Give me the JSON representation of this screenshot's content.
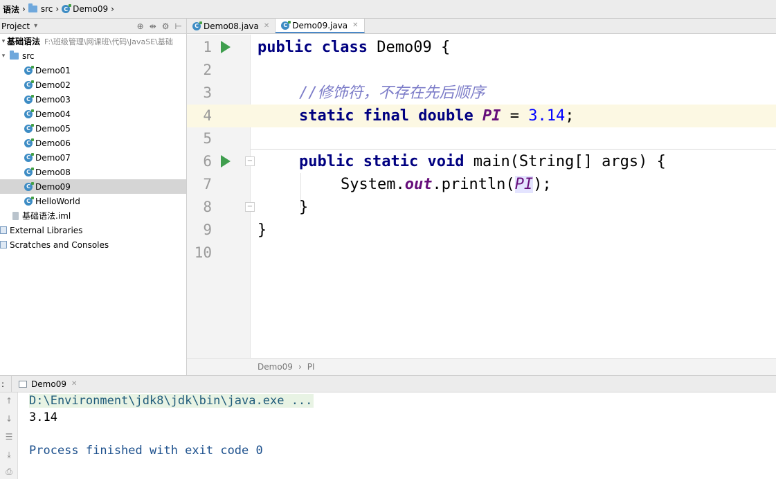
{
  "navbar": {
    "items": [
      "语法",
      "src",
      "Demo09"
    ]
  },
  "project_panel": {
    "title": "Project",
    "dropdown": "▾",
    "root": {
      "name": "基础语法",
      "path": "F:\\班级管理\\网课班\\代码\\JavaSE\\基础"
    },
    "src_label": "src",
    "classes": [
      "Demo01",
      "Demo02",
      "Demo03",
      "Demo04",
      "Demo05",
      "Demo06",
      "Demo07",
      "Demo08",
      "Demo09",
      "HelloWorld"
    ],
    "selected": "Demo09",
    "iml_file": "基础语法.iml",
    "external_libraries": "External Libraries",
    "scratches": "Scratches and Consoles"
  },
  "tabs": [
    {
      "label": "Demo08.java",
      "active": false
    },
    {
      "label": "Demo09.java",
      "active": true
    }
  ],
  "editor": {
    "line_numbers": [
      "1",
      "2",
      "3",
      "4",
      "5",
      "6",
      "7",
      "8",
      "9",
      "10"
    ],
    "line1": {
      "kw1": "public",
      "kw2": "class",
      "name": "Demo09",
      "brace": "{"
    },
    "line3": {
      "comment": "//修饰符，不存在先后顺序"
    },
    "line4": {
      "kw1": "static",
      "kw2": "final",
      "kw3": "double",
      "field": "PI",
      "op": "=",
      "value": "3.14",
      "end": ";"
    },
    "line6": {
      "kw1": "public",
      "kw2": "static",
      "kw3": "void",
      "rest": "main(String[] args) {"
    },
    "line7": {
      "pre": "System.",
      "stat": "out",
      "mid": ".println(",
      "field": "PI",
      "end": ");"
    },
    "line8": {
      "text": "}"
    },
    "line9": {
      "text": "}"
    }
  },
  "editor_breadcrumb": {
    "class": "Demo09",
    "sep": "›",
    "member": "PI"
  },
  "run_window": {
    "prefix": ":",
    "tab_label": "Demo09",
    "console_lines": [
      "D:\\Environment\\jdk8\\jdk\\bin\\java.exe ...",
      "3.14",
      "",
      "Process finished with exit code 0"
    ]
  },
  "colors": {
    "keyword": "#000080",
    "number": "#0000ff",
    "comment": "#7c7cc8",
    "static_field": "#660e7a",
    "run_icon": "#3f9e4e",
    "current_line": "#fcf8e3"
  }
}
